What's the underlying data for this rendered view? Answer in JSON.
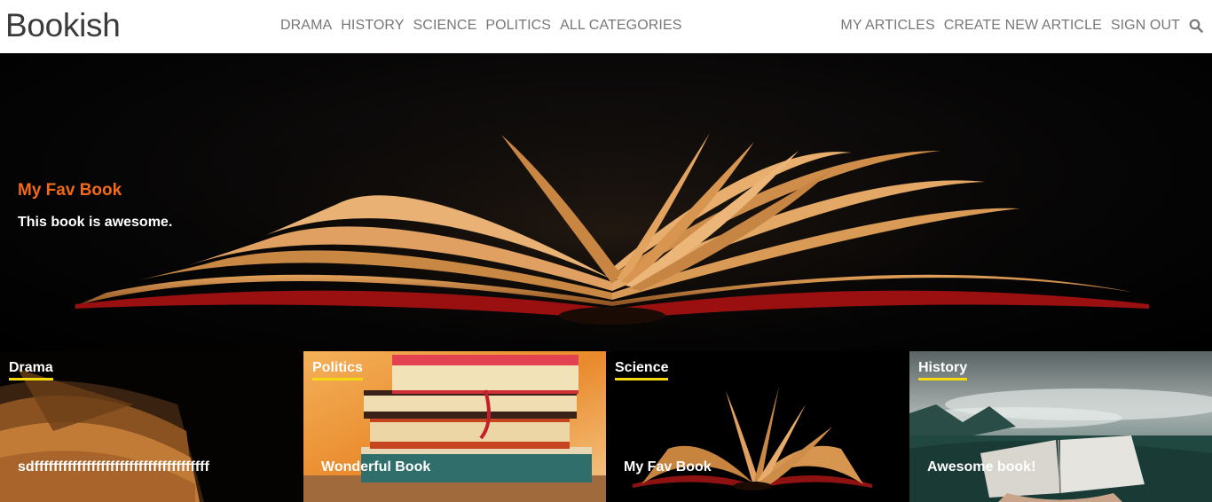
{
  "brand": "Bookish",
  "nav": {
    "categories": [
      "DRAMA",
      "HISTORY",
      "SCIENCE",
      "POLITICS",
      "ALL CATEGORIES"
    ],
    "account": [
      "MY ARTICLES",
      "CREATE NEW ARTICLE",
      "SIGN OUT"
    ],
    "search_icon": "search-icon"
  },
  "hero": {
    "title": "My Fav Book",
    "description": "This book is awesome."
  },
  "cards": [
    {
      "category": "Drama",
      "title": "sdfffffffffffffffffffffffffffffffffffff"
    },
    {
      "category": "Politics",
      "title": "Wonderful Book"
    },
    {
      "category": "Science",
      "title": "My Fav Book"
    },
    {
      "category": "History",
      "title": "Awesome book!"
    }
  ],
  "colors": {
    "accent": "#f26a15",
    "underline": "#f5d90f",
    "nav_text": "#777777",
    "brand_text": "#3b3b3b"
  }
}
